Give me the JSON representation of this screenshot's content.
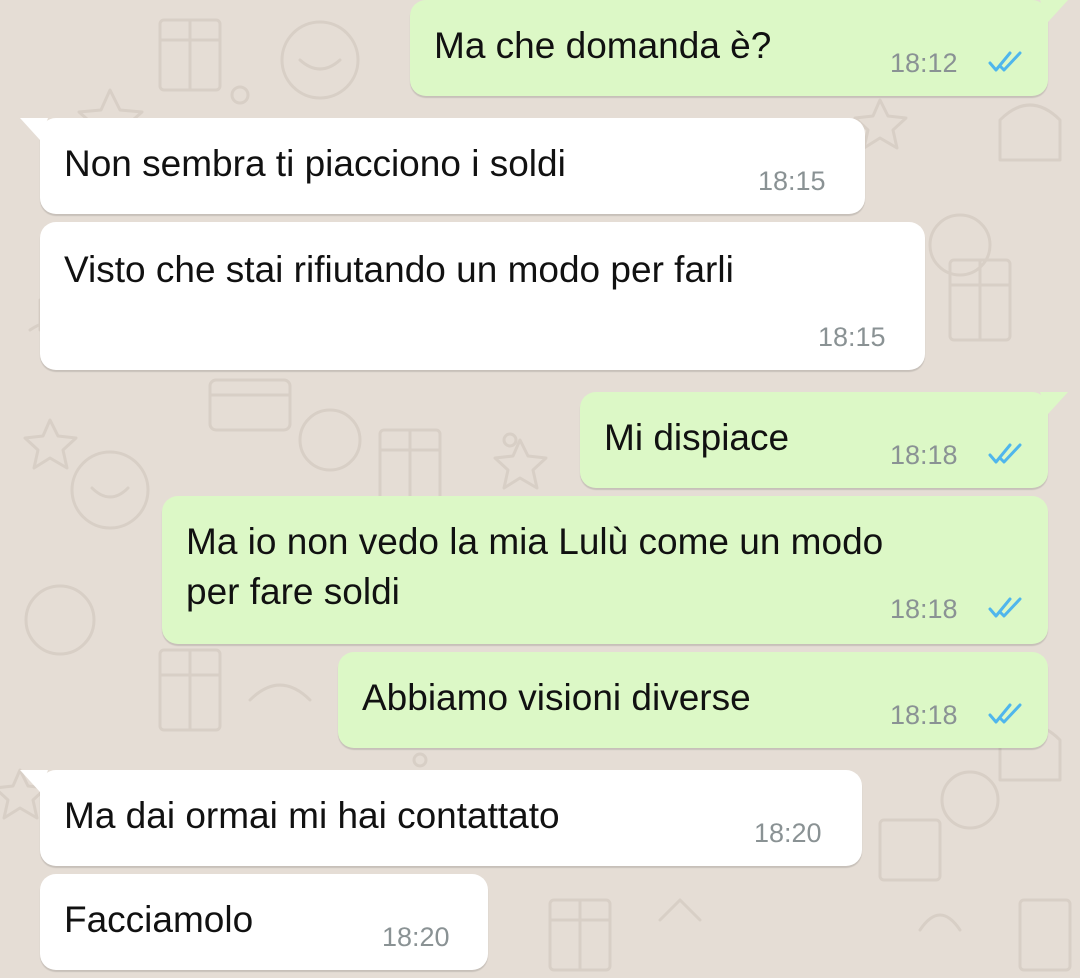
{
  "conversation": {
    "messages": [
      {
        "direction": "outgoing",
        "text": "Ma che domanda è?",
        "time": "18:12",
        "status": "read"
      },
      {
        "direction": "incoming",
        "text": "Non sembra ti piacciono i soldi",
        "time": "18:15"
      },
      {
        "direction": "incoming",
        "text": "Visto che stai rifiutando un modo per farli",
        "time": "18:15"
      },
      {
        "direction": "outgoing",
        "text": "Mi dispiace",
        "time": "18:18",
        "status": "read"
      },
      {
        "direction": "outgoing",
        "text_lines": [
          "Ma io non vedo la mia Lulù come un modo",
          "per fare soldi"
        ],
        "time": "18:18",
        "status": "read"
      },
      {
        "direction": "outgoing",
        "text": "Abbiamo visioni diverse",
        "time": "18:18",
        "status": "read"
      },
      {
        "direction": "incoming",
        "text": "Ma dai ormai mi hai contattato",
        "time": "18:20"
      },
      {
        "direction": "incoming",
        "text": "Facciamolo",
        "time": "18:20"
      }
    ]
  },
  "colors": {
    "background": "#e5ddd5",
    "incoming_bubble": "#ffffff",
    "outgoing_bubble": "#dcf8c6",
    "read_ticks": "#4fb6ec",
    "timestamp": "#8a9294"
  },
  "icons": {
    "read_receipt": "double-check-icon",
    "wallpaper": "doodle-pattern"
  }
}
